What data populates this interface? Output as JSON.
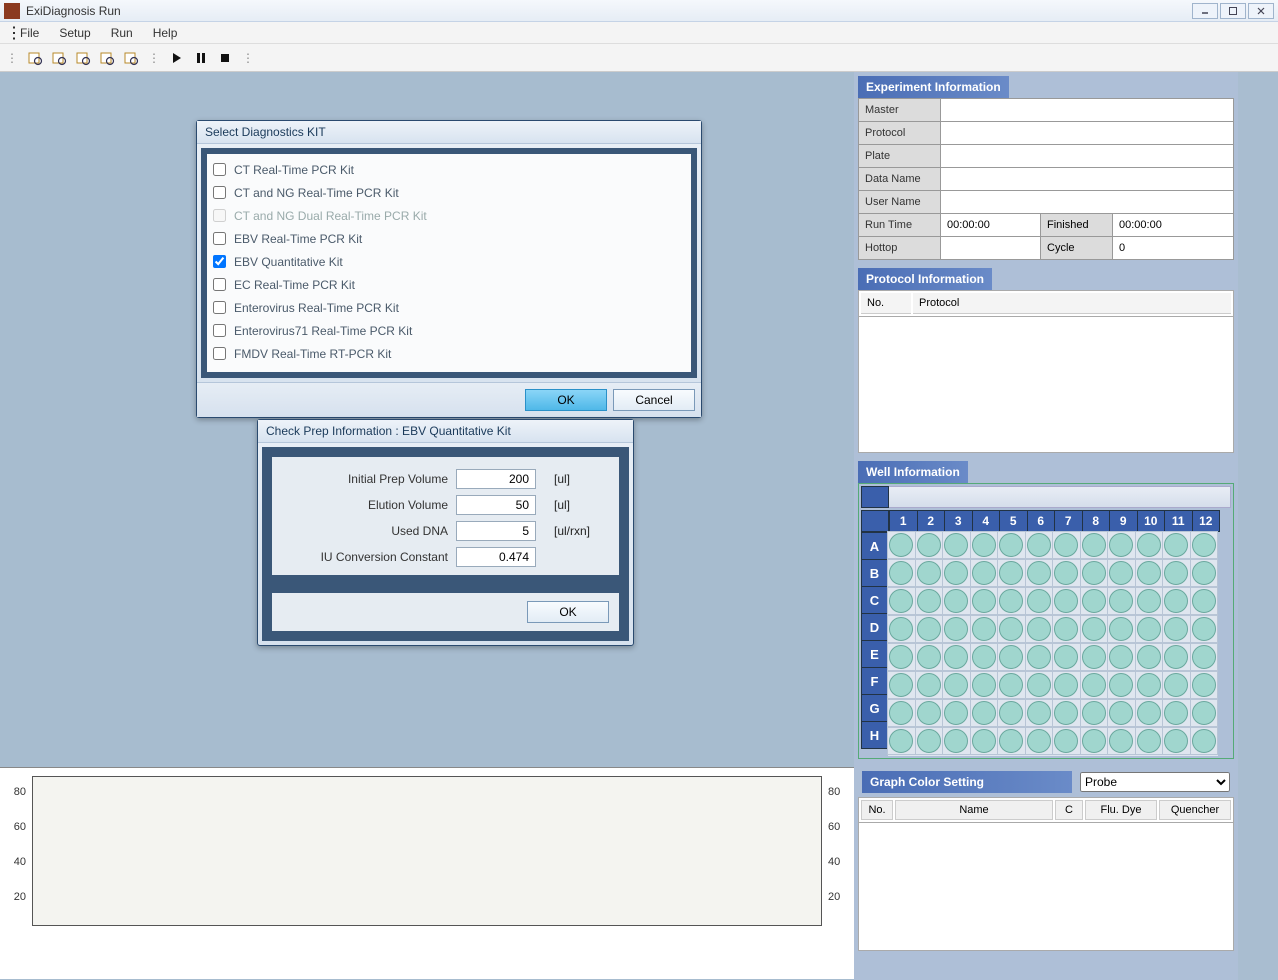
{
  "app": {
    "title": "ExiDiagnosis Run"
  },
  "menu": {
    "file": "File",
    "setup": "Setup",
    "run": "Run",
    "help": "Help"
  },
  "kit_dialog": {
    "title": "Select Diagnostics KIT",
    "items": [
      {
        "label": "CT Real-Time PCR Kit",
        "checked": false,
        "disabled": false
      },
      {
        "label": "CT and NG Real-Time PCR Kit",
        "checked": false,
        "disabled": false
      },
      {
        "label": "CT and NG Dual Real-Time PCR Kit",
        "checked": false,
        "disabled": true
      },
      {
        "label": "EBV Real-Time PCR Kit",
        "checked": false,
        "disabled": false
      },
      {
        "label": "EBV Quantitative Kit",
        "checked": true,
        "disabled": false
      },
      {
        "label": "EC Real-Time PCR Kit",
        "checked": false,
        "disabled": false
      },
      {
        "label": "Enterovirus Real-Time PCR Kit",
        "checked": false,
        "disabled": false
      },
      {
        "label": "Enterovirus71 Real-Time PCR Kit",
        "checked": false,
        "disabled": false
      },
      {
        "label": "FMDV Real-Time RT-PCR Kit",
        "checked": false,
        "disabled": false
      }
    ],
    "ok": "OK",
    "cancel": "Cancel"
  },
  "prep_dialog": {
    "title": "Check Prep Information : EBV Quantitative Kit",
    "rows": [
      {
        "label": "Initial Prep Volume",
        "value": "200",
        "unit": "[ul]"
      },
      {
        "label": "Elution Volume",
        "value": "50",
        "unit": "[ul]"
      },
      {
        "label": "Used DNA",
        "value": "5",
        "unit": "[ul/rxn]"
      },
      {
        "label": "IU Conversion Constant",
        "value": "0.474",
        "unit": ""
      }
    ],
    "ok": "OK"
  },
  "exp_info": {
    "header": "Experiment Information",
    "master": "Master",
    "master_v": "",
    "protocol": "Protocol",
    "protocol_v": "",
    "plate": "Plate",
    "plate_v": "",
    "dataname": "Data Name",
    "dataname_v": "",
    "username": "User Name",
    "username_v": "",
    "runtime": "Run Time",
    "runtime_v": "00:00:00",
    "finished": "Finished",
    "finished_v": "00:00:00",
    "hottop": "Hottop",
    "hottop_v": "",
    "cycle": "Cycle",
    "cycle_v": "0"
  },
  "protocol_info": {
    "header": "Protocol Information",
    "col_no": "No.",
    "col_protocol": "Protocol"
  },
  "well_info": {
    "header": "Well Information",
    "cols": [
      "1",
      "2",
      "3",
      "4",
      "5",
      "6",
      "7",
      "8",
      "9",
      "10",
      "11",
      "12"
    ],
    "rows": [
      "A",
      "B",
      "C",
      "D",
      "E",
      "F",
      "G",
      "H"
    ]
  },
  "gcs": {
    "header": "Graph Color Setting",
    "select_value": "Probe",
    "col_no": "No.",
    "col_name": "Name",
    "col_c": "C",
    "col_flu": "Flu. Dye",
    "col_que": "Quencher"
  },
  "chart_data": {
    "type": "line",
    "title": "",
    "xlabel": "",
    "ylabel": "",
    "ylim": [
      0,
      90
    ],
    "yticks": [
      20,
      40,
      60,
      80
    ],
    "series": []
  }
}
